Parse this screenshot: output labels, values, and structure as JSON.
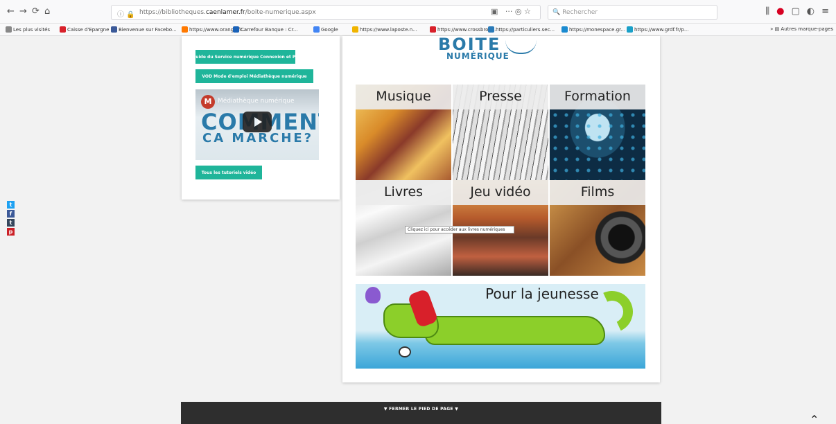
{
  "browser": {
    "url_prefix": "https://bibliotheques.",
    "url_host": "caenlamer.fr",
    "url_path": "/boite-numerique.aspx",
    "search_placeholder": "Rechercher",
    "bookmarks": [
      {
        "label": "Les plus visités",
        "color": "#888888"
      },
      {
        "label": "Caisse d'Epargne",
        "color": "#d8202a"
      },
      {
        "label": "Bienvenue sur Facebo...",
        "color": "#3b5998"
      },
      {
        "label": "https://www.orange.fr...",
        "color": "#ff7900"
      },
      {
        "label": "Carrefour Banque : Cr...",
        "color": "#1a62b8"
      },
      {
        "label": "Google",
        "color": "#4285f4"
      },
      {
        "label": "https://www.laposte.n...",
        "color": "#f0b400"
      },
      {
        "label": "https://www.crossbrow...",
        "color": "#d8202a"
      },
      {
        "label": "https://particuliers.sec...",
        "color": "#2a7ab8"
      },
      {
        "label": "https://monespace.gr...",
        "color": "#1a8ad0"
      },
      {
        "label": "https://www.grdf.fr/p...",
        "color": "#1aa0c8"
      }
    ],
    "bookmarks_more": "Autres marque-pages"
  },
  "left_panel": {
    "button1": "Guide du Service numérique   Connexion et PC",
    "button2": "VOD   Mode d'emploi Médiathèque numérique",
    "video_title": "Médiathèque numérique",
    "video_big1": "COMMENT",
    "video_big2": "CA MARCHE?",
    "button3": "Tous les tutoriels vidéo"
  },
  "main": {
    "logo_top": "BOITE",
    "logo_bottom": "NUMÉRIQUE",
    "tiles": [
      {
        "label": "Musique"
      },
      {
        "label": "Presse"
      },
      {
        "label": "Formation"
      },
      {
        "label": "Livres"
      },
      {
        "label": "Jeu vidéo"
      },
      {
        "label": "Films"
      }
    ],
    "tooltip": "Cliquez ici pour accéder aux livres numériques",
    "jeunesse": "Pour la jeunesse"
  },
  "footer": {
    "label": "▼  FERMER LE PIED DE PAGE  ▼"
  },
  "social": [
    {
      "icon": "twitter-icon",
      "glyph": "t",
      "color": "#1da1f2"
    },
    {
      "icon": "facebook-icon",
      "glyph": "f",
      "color": "#3b5998"
    },
    {
      "icon": "tumblr-icon",
      "glyph": "t",
      "color": "#35465c"
    },
    {
      "icon": "pinterest-icon",
      "glyph": "p",
      "color": "#cb2027"
    }
  ]
}
